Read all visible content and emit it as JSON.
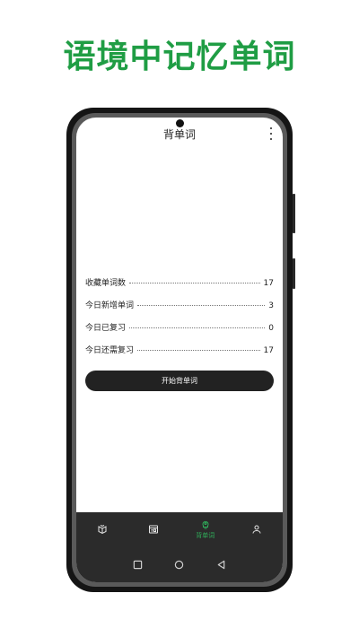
{
  "headline": "语境中记忆单词",
  "app": {
    "title": "背单词",
    "stats": [
      {
        "label": "收藏单词数",
        "value": "17"
      },
      {
        "label": "今日新增单词",
        "value": "3"
      },
      {
        "label": "今日已复习",
        "value": "0"
      },
      {
        "label": "今日还需复习",
        "value": "17"
      }
    ],
    "start_button": "开始背单词"
  },
  "bottom_nav": {
    "items": [
      {
        "icon": "book-icon",
        "label": ""
      },
      {
        "icon": "news-icon",
        "label": ""
      },
      {
        "icon": "brain-icon",
        "label": "背单词",
        "active": true
      },
      {
        "icon": "user-icon",
        "label": ""
      }
    ]
  },
  "colors": {
    "accent": "#2fae5a",
    "headline": "#1f9d44",
    "button": "#222222",
    "nav_bg": "#2b2b2b"
  }
}
